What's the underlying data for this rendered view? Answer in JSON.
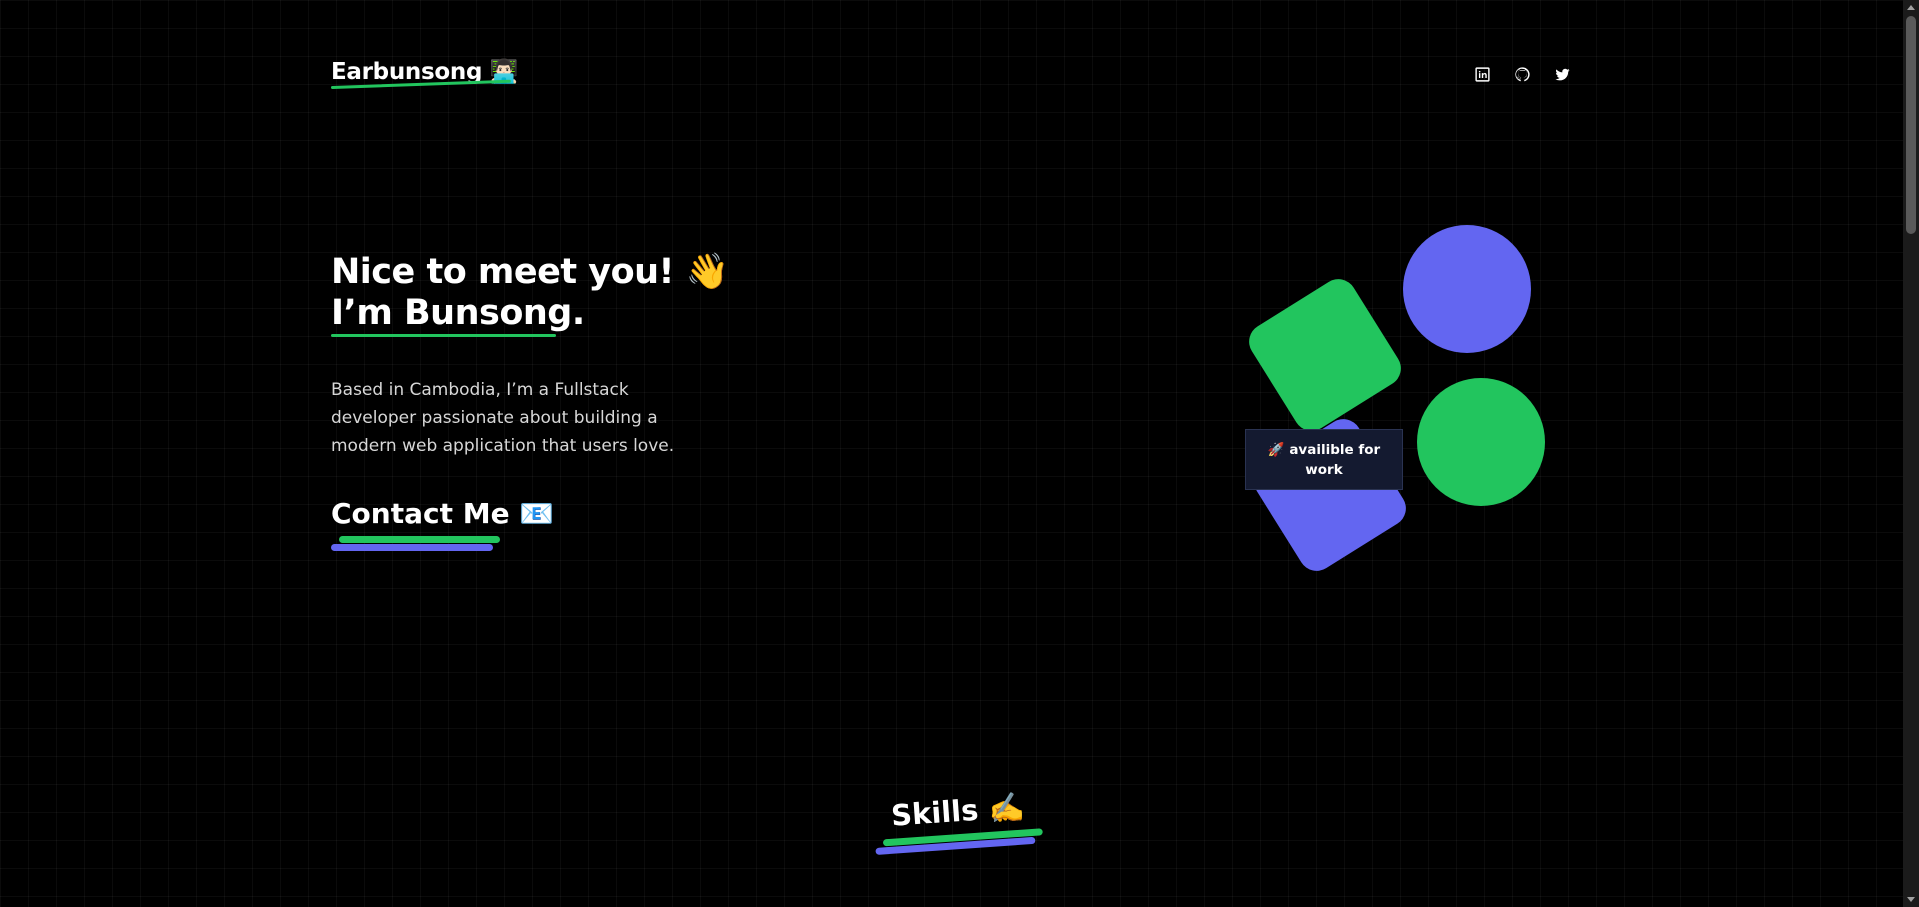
{
  "header": {
    "logo_text": "Earbunsong 👨🏻‍💻",
    "social": [
      {
        "name": "linkedin-icon"
      },
      {
        "name": "github-icon"
      },
      {
        "name": "twitter-icon"
      }
    ]
  },
  "hero": {
    "title_line1": "Nice to meet you! 👋",
    "title_line2": "I’m Bunsong.",
    "description": "Based in Cambodia, I’m a Fullstack developer passionate about building a modern web application that users love.",
    "contact_label": "Contact Me 📧"
  },
  "badge": {
    "text": "🚀 availible for work"
  },
  "skills": {
    "title": "Skills ✍️"
  },
  "colors": {
    "background": "#000000",
    "accent_green": "#22c55e",
    "accent_indigo": "#6366f1",
    "badge_bg": "#141a30"
  }
}
